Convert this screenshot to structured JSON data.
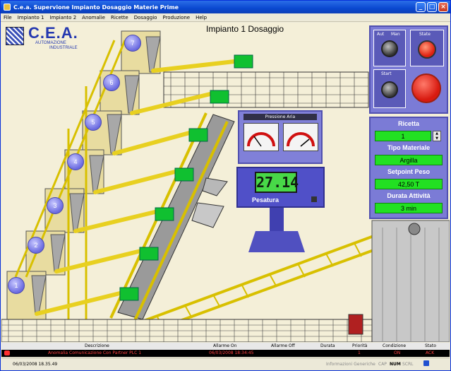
{
  "window": {
    "title": "C.e.a. Supervione Impianto Dosaggio Materie Prime"
  },
  "menu": [
    "File",
    "Impianto 1",
    "Impianto 2",
    "Anomalie",
    "Ricette",
    "Dosaggio",
    "Produzione",
    "Help"
  ],
  "logo": {
    "brand": "C.E.A.",
    "sub1": "AUTOMAZIONE",
    "sub2": "INDUSTRIALE"
  },
  "page_title": "Impianto 1 Dosaggio",
  "silos": [
    "1",
    "2",
    "3",
    "4",
    "5",
    "6",
    "7"
  ],
  "controls": {
    "aut": "Aut",
    "man": "Man",
    "state": "State",
    "start": "Start"
  },
  "pressure": {
    "title": "Pressione Aria"
  },
  "scale": {
    "display": "27.14",
    "label": "Pesatura"
  },
  "recipe": {
    "ricetta_label": "Ricetta",
    "ricetta_value": "1",
    "tipo_label": "Tipo Materiale",
    "tipo_value": "Argilla",
    "setpoint_label": "Setpoint Peso",
    "setpoint_value": "42,50 T",
    "durata_label": "Durata Attività",
    "durata_value": "3 min"
  },
  "alarm_table": {
    "headers": [
      "Descrizione",
      "Allarme On",
      "Allarme Off",
      "Durata",
      "Priorità",
      "Condizione",
      "Stato"
    ],
    "row": [
      "Anomalia Comunicazione Con Partner PLC 1",
      "06/03/2008 18:34:45",
      "",
      "",
      "1",
      "ON",
      "ACK"
    ]
  },
  "status": {
    "datetime": "06/03/2008 18.35.49",
    "info": "Informazioni Generiche",
    "caps": "CAP",
    "num": "NUM",
    "scrl": "SCRL"
  }
}
